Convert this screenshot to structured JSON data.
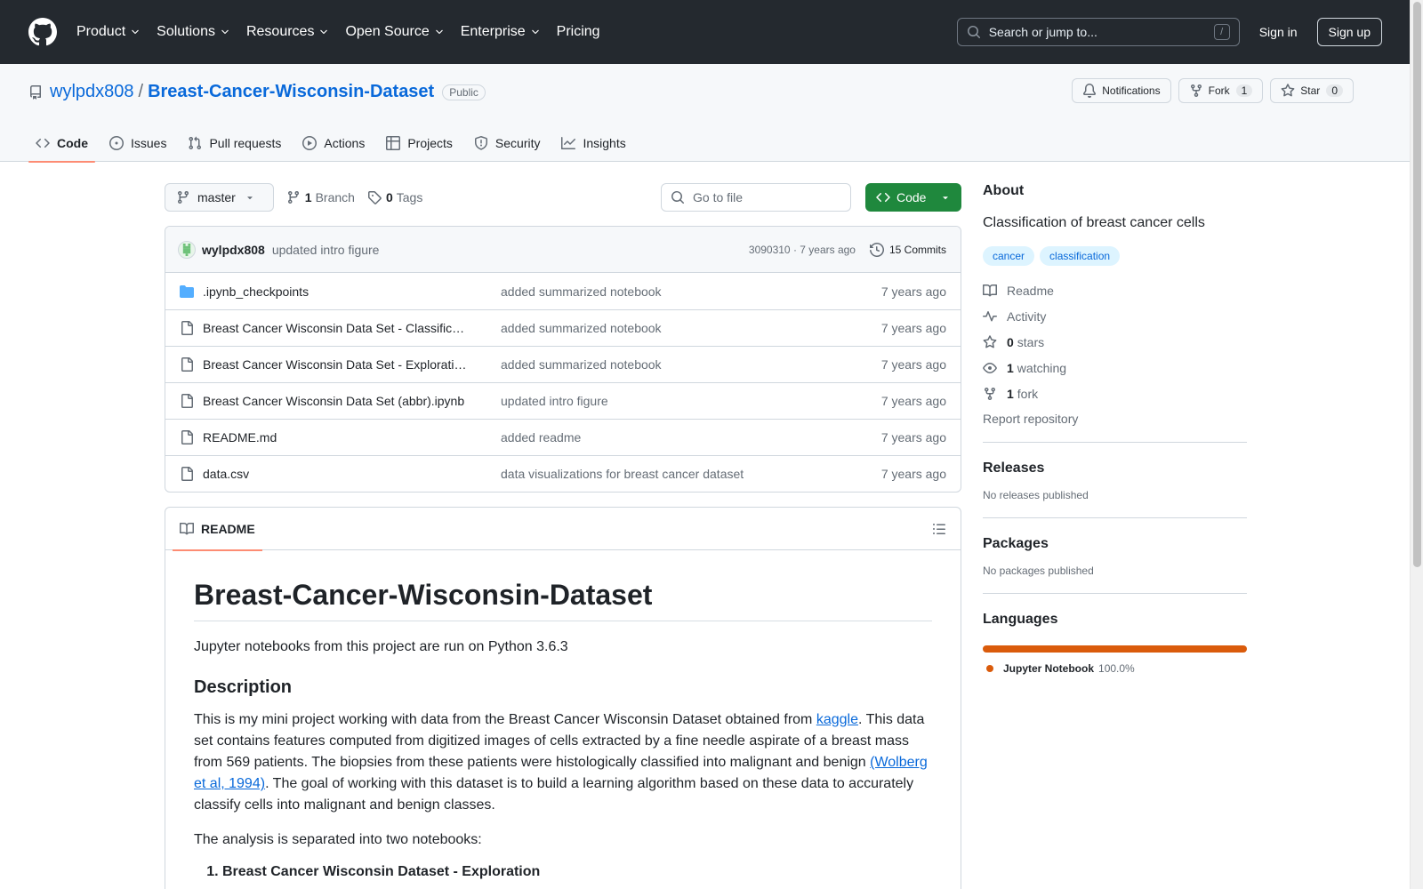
{
  "header": {
    "nav": [
      "Product",
      "Solutions",
      "Resources",
      "Open Source",
      "Enterprise",
      "Pricing"
    ],
    "search_placeholder": "Search or jump to...",
    "search_key": "/",
    "sign_in": "Sign in",
    "sign_up": "Sign up"
  },
  "repo": {
    "owner": "wylpdx808",
    "separator": "/",
    "name": "Breast-Cancer-Wisconsin-Dataset",
    "visibility": "Public",
    "notifications_label": "Notifications",
    "fork_label": "Fork",
    "fork_count": "1",
    "star_label": "Star",
    "star_count": "0",
    "tabs": [
      "Code",
      "Issues",
      "Pull requests",
      "Actions",
      "Projects",
      "Security",
      "Insights"
    ]
  },
  "toolbar": {
    "branch": "master",
    "branch_count": "1",
    "branch_label": "Branch",
    "tag_count": "0",
    "tag_label": "Tags",
    "goto_placeholder": "Go to file",
    "code_label": "Code"
  },
  "commit": {
    "author": "wylpdx808",
    "message": "updated intro figure",
    "hash_time": "3090310 · 7 years ago",
    "commits_label": "15 Commits"
  },
  "files": [
    {
      "name": ".ipynb_checkpoints",
      "type": "folder",
      "message": "added summarized notebook",
      "age": "7 years ago"
    },
    {
      "name": "Breast Cancer Wisconsin Data Set - Classific…",
      "type": "file",
      "message": "added summarized notebook",
      "age": "7 years ago"
    },
    {
      "name": "Breast Cancer Wisconsin Data Set - Explorati…",
      "type": "file",
      "message": "added summarized notebook",
      "age": "7 years ago"
    },
    {
      "name": "Breast Cancer Wisconsin Data Set (abbr).ipynb",
      "type": "file",
      "message": "updated intro figure",
      "age": "7 years ago"
    },
    {
      "name": "README.md",
      "type": "file",
      "message": "added readme",
      "age": "7 years ago"
    },
    {
      "name": "data.csv",
      "type": "file",
      "message": "data visualizations for breast cancer dataset",
      "age": "7 years ago"
    }
  ],
  "readme": {
    "tab_label": "README",
    "title": "Breast-Cancer-Wisconsin-Dataset",
    "intro": "Jupyter notebooks from this project are run on Python 3.6.3",
    "desc_heading": "Description",
    "desc_part1": "This is my mini project working with data from the Breast Cancer Wisconsin Dataset obtained from ",
    "desc_link1": "kaggle",
    "desc_part2": ". This data set contains features computed from digitized images of cells extracted by a fine needle aspirate of a breast mass from 569 patients. The biopsies from these patients were histologically classified into malignant and benign ",
    "desc_link2": "(Wolberg et al, 1994)",
    "desc_part3": ". The goal of working with this dataset is to build a learning algorithm based on these data to accurately classify cells into malignant and benign classes.",
    "analysis": "The analysis is separated into two notebooks:",
    "list_item_1": "Breast Cancer Wisconsin Dataset - Exploration"
  },
  "sidebar": {
    "about_heading": "About",
    "description": "Classification of breast cancer cells",
    "topics": [
      "cancer",
      "classification"
    ],
    "readme": "Readme",
    "activity": "Activity",
    "stars_count": "0",
    "stars_label": "stars",
    "watching_count": "1",
    "watching_label": "watching",
    "forks_count": "1",
    "forks_label": "fork",
    "report": "Report repository",
    "releases_heading": "Releases",
    "releases_text": "No releases published",
    "packages_heading": "Packages",
    "packages_text": "No packages published",
    "languages_heading": "Languages",
    "language_name": "Jupyter Notebook",
    "language_pct": "100.0%",
    "language_share": 1.0,
    "language_color": "#DA5B0B"
  }
}
